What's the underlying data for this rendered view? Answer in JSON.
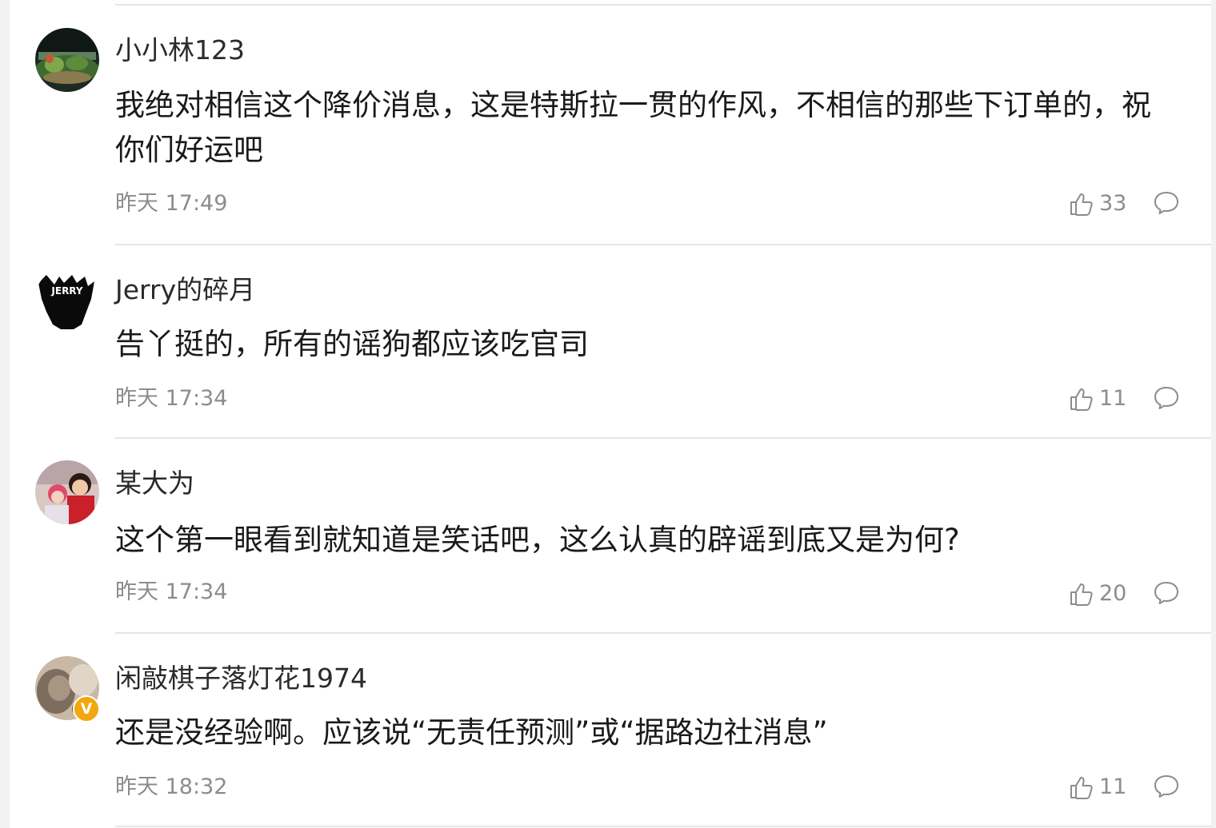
{
  "comments": [
    {
      "username": "小小林123",
      "content": "我绝对相信这个降价消息，这是特斯拉一贯的作风，不相信的那些下订单的，祝你们好运吧",
      "time": "昨天 17:49",
      "likes": "33",
      "avatar": "avatar-aquarium-photo",
      "verified": false
    },
    {
      "username": "Jerry的碎月",
      "content": "告丫挺的，所有的谣狗都应该吃官司",
      "time": "昨天 17:34",
      "likes": "11",
      "avatar": "avatar-jerry-silhouette",
      "avatar_text": "JERRY",
      "verified": false
    },
    {
      "username": "某大为",
      "content": "这个第一眼看到就知道是笑话吧，这么认真的辟谣到底又是为何?",
      "time": "昨天 17:34",
      "likes": "20",
      "avatar": "avatar-family-photo",
      "verified": false
    },
    {
      "username": "闲敲棋子落灯花1974",
      "content": "还是没经验啊。应该说“无责任预测”或“据路边社消息”",
      "time": "昨天 18:32",
      "likes": "11",
      "avatar": "avatar-blurred-photo",
      "verified": true,
      "verified_mark": "V"
    }
  ],
  "icons": {
    "like": "thumbs-up-icon",
    "reply": "comment-bubble-icon"
  },
  "colors": {
    "text_primary": "#1a1a1a",
    "text_secondary": "#8c8c8c",
    "divider": "#e6e6e6",
    "verified_badge": "#f2a70c"
  }
}
